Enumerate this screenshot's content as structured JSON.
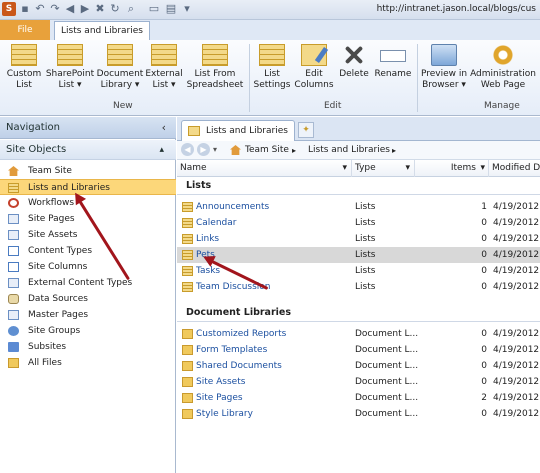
{
  "window": {
    "url": "http://intranet.jason.local/blogs/cus"
  },
  "ribbon": {
    "file_tab": "File",
    "active_tab": "Lists and Libraries",
    "buttons": {
      "custom_list": "Custom\nList",
      "sharepoint_list": "SharePoint\nList ▾",
      "document_library": "Document\nLibrary ▾",
      "external_list": "External\nList ▾",
      "list_from_spreadsheet": "List From\nSpreadsheet",
      "list_settings": "List\nSettings",
      "edit_columns": "Edit\nColumns",
      "delete": "Delete",
      "rename": "Rename",
      "preview_in_browser": "Preview in\nBrowser ▾",
      "administration_web_page": "Administration\nWeb Page"
    },
    "groups": {
      "new": "New",
      "edit": "Edit",
      "manage": "Manage"
    }
  },
  "navigation": {
    "header": "Navigation",
    "collapse_icon": "‹",
    "site_objects": "Site Objects",
    "site_objects_collapse": "▴",
    "items": [
      {
        "label": "Team Site",
        "icon": "house-icon"
      },
      {
        "label": "Lists and Libraries",
        "icon": "list-icon"
      },
      {
        "label": "Workflows",
        "icon": "workflow-icon"
      },
      {
        "label": "Site Pages",
        "icon": "page-icon"
      },
      {
        "label": "Site Assets",
        "icon": "asset-icon"
      },
      {
        "label": "Content Types",
        "icon": "content-type-icon"
      },
      {
        "label": "Site Columns",
        "icon": "column-icon"
      },
      {
        "label": "External Content Types",
        "icon": "external-icon"
      },
      {
        "label": "Data Sources",
        "icon": "database-icon"
      },
      {
        "label": "Master Pages",
        "icon": "master-page-icon"
      },
      {
        "label": "Site Groups",
        "icon": "group-icon"
      },
      {
        "label": "Subsites",
        "icon": "subsite-icon"
      },
      {
        "label": "All Files",
        "icon": "folder-icon"
      }
    ]
  },
  "main": {
    "tab_label": "Lists and Libraries",
    "breadcrumb": {
      "site": "Team Site",
      "sep": "▸",
      "current": "Lists and Libraries"
    },
    "columns": {
      "name": "Name",
      "type": "Type",
      "items": "Items",
      "modified": "Modified Da"
    },
    "sort_icon": "▾",
    "sections": {
      "lists": "Lists",
      "libraries": "Document Libraries"
    },
    "lists": [
      {
        "name": "Announcements",
        "type": "Lists",
        "items": "1",
        "modified": "4/19/2012"
      },
      {
        "name": "Calendar",
        "type": "Lists",
        "items": "0",
        "modified": "4/19/2012"
      },
      {
        "name": "Links",
        "type": "Lists",
        "items": "0",
        "modified": "4/19/2012"
      },
      {
        "name": "Pets",
        "type": "Lists",
        "items": "0",
        "modified": "4/19/2012"
      },
      {
        "name": "Tasks",
        "type": "Lists",
        "items": "0",
        "modified": "4/19/2012"
      },
      {
        "name": "Team Discussion",
        "type": "Lists",
        "items": "0",
        "modified": "4/19/2012"
      }
    ],
    "libraries": [
      {
        "name": "Customized Reports",
        "type": "Document L...",
        "items": "0",
        "modified": "4/19/2012"
      },
      {
        "name": "Form Templates",
        "type": "Document L...",
        "items": "0",
        "modified": "4/19/2012"
      },
      {
        "name": "Shared Documents",
        "type": "Document L...",
        "items": "0",
        "modified": "4/19/2012"
      },
      {
        "name": "Site Assets",
        "type": "Document L...",
        "items": "0",
        "modified": "4/19/2012"
      },
      {
        "name": "Site Pages",
        "type": "Document L...",
        "items": "2",
        "modified": "4/19/2012"
      },
      {
        "name": "Style Library",
        "type": "Document L...",
        "items": "0",
        "modified": "4/19/2012"
      }
    ]
  }
}
